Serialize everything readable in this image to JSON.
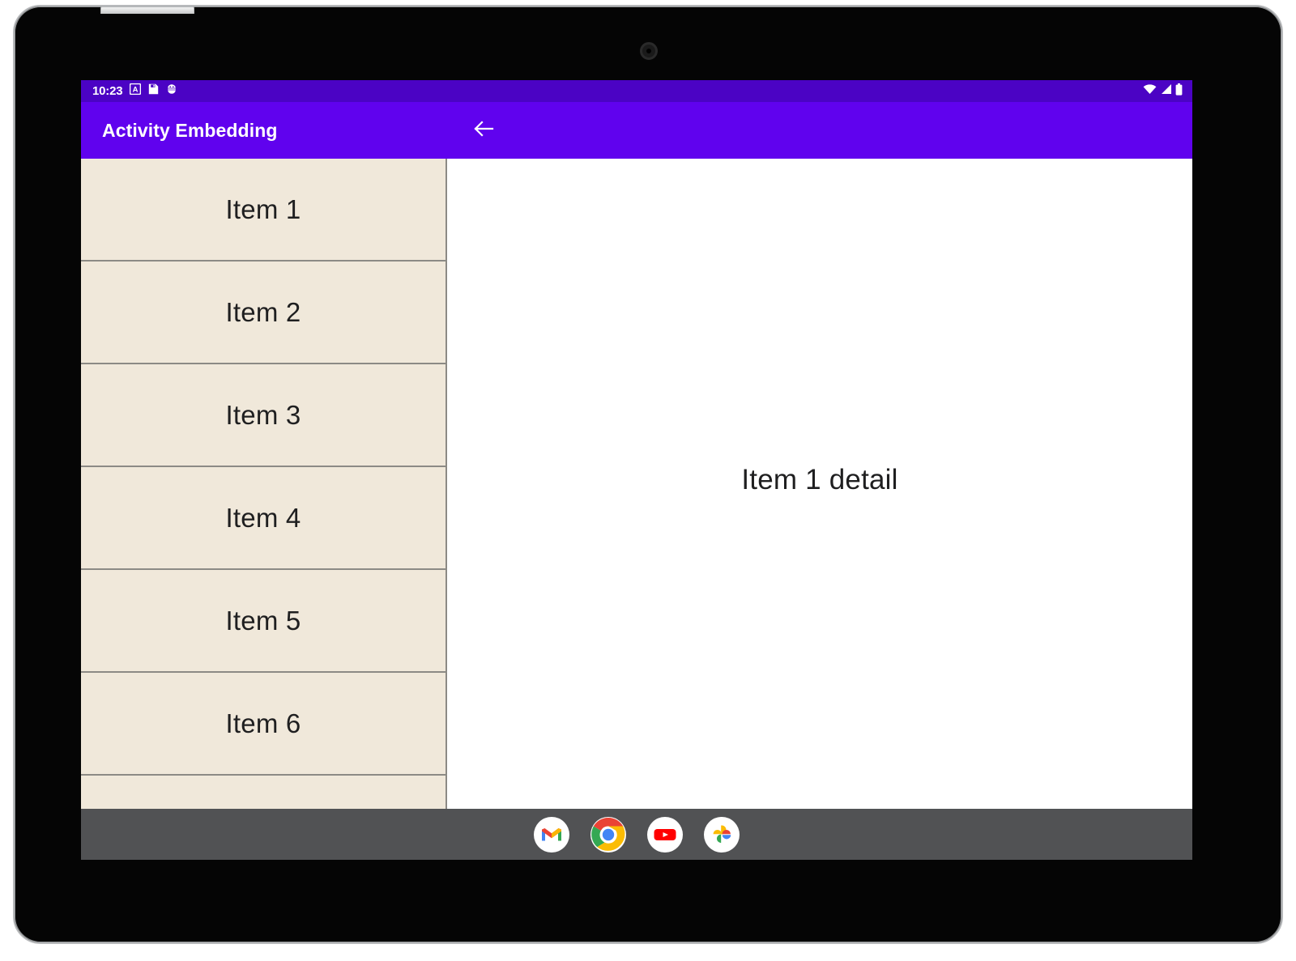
{
  "device": {
    "camera_icon": "camera-lens",
    "side_button": "power-button"
  },
  "status_bar": {
    "clock": "10:23",
    "background_color": "#4b03c4",
    "left_icons": [
      {
        "name": "a-badge-icon",
        "glyph": "A"
      },
      {
        "name": "save-disk-icon",
        "glyph": ""
      },
      {
        "name": "android-debug-icon",
        "glyph": ""
      }
    ],
    "right_icons": [
      {
        "name": "wifi-icon"
      },
      {
        "name": "cellular-signal-icon"
      },
      {
        "name": "battery-icon"
      }
    ]
  },
  "app_bar": {
    "title": "Activity Embedding",
    "background_color": "#6002ee",
    "back_icon": "back-arrow-icon"
  },
  "list_pane": {
    "background_color": "#f0e8da",
    "divider_color": "#8c8a85",
    "items": [
      {
        "label": "Item 1"
      },
      {
        "label": "Item 2"
      },
      {
        "label": "Item 3"
      },
      {
        "label": "Item 4"
      },
      {
        "label": "Item 5"
      },
      {
        "label": "Item 6"
      },
      {
        "label": ""
      }
    ]
  },
  "detail_pane": {
    "text": "Item 1 detail",
    "background_color": "#ffffff"
  },
  "taskbar": {
    "background_color": "#515254",
    "apps": [
      {
        "name": "gmail-app-icon",
        "label": "Gmail"
      },
      {
        "name": "chrome-app-icon",
        "label": "Chrome"
      },
      {
        "name": "youtube-app-icon",
        "label": "YouTube"
      },
      {
        "name": "photos-app-icon",
        "label": "Photos"
      }
    ]
  }
}
